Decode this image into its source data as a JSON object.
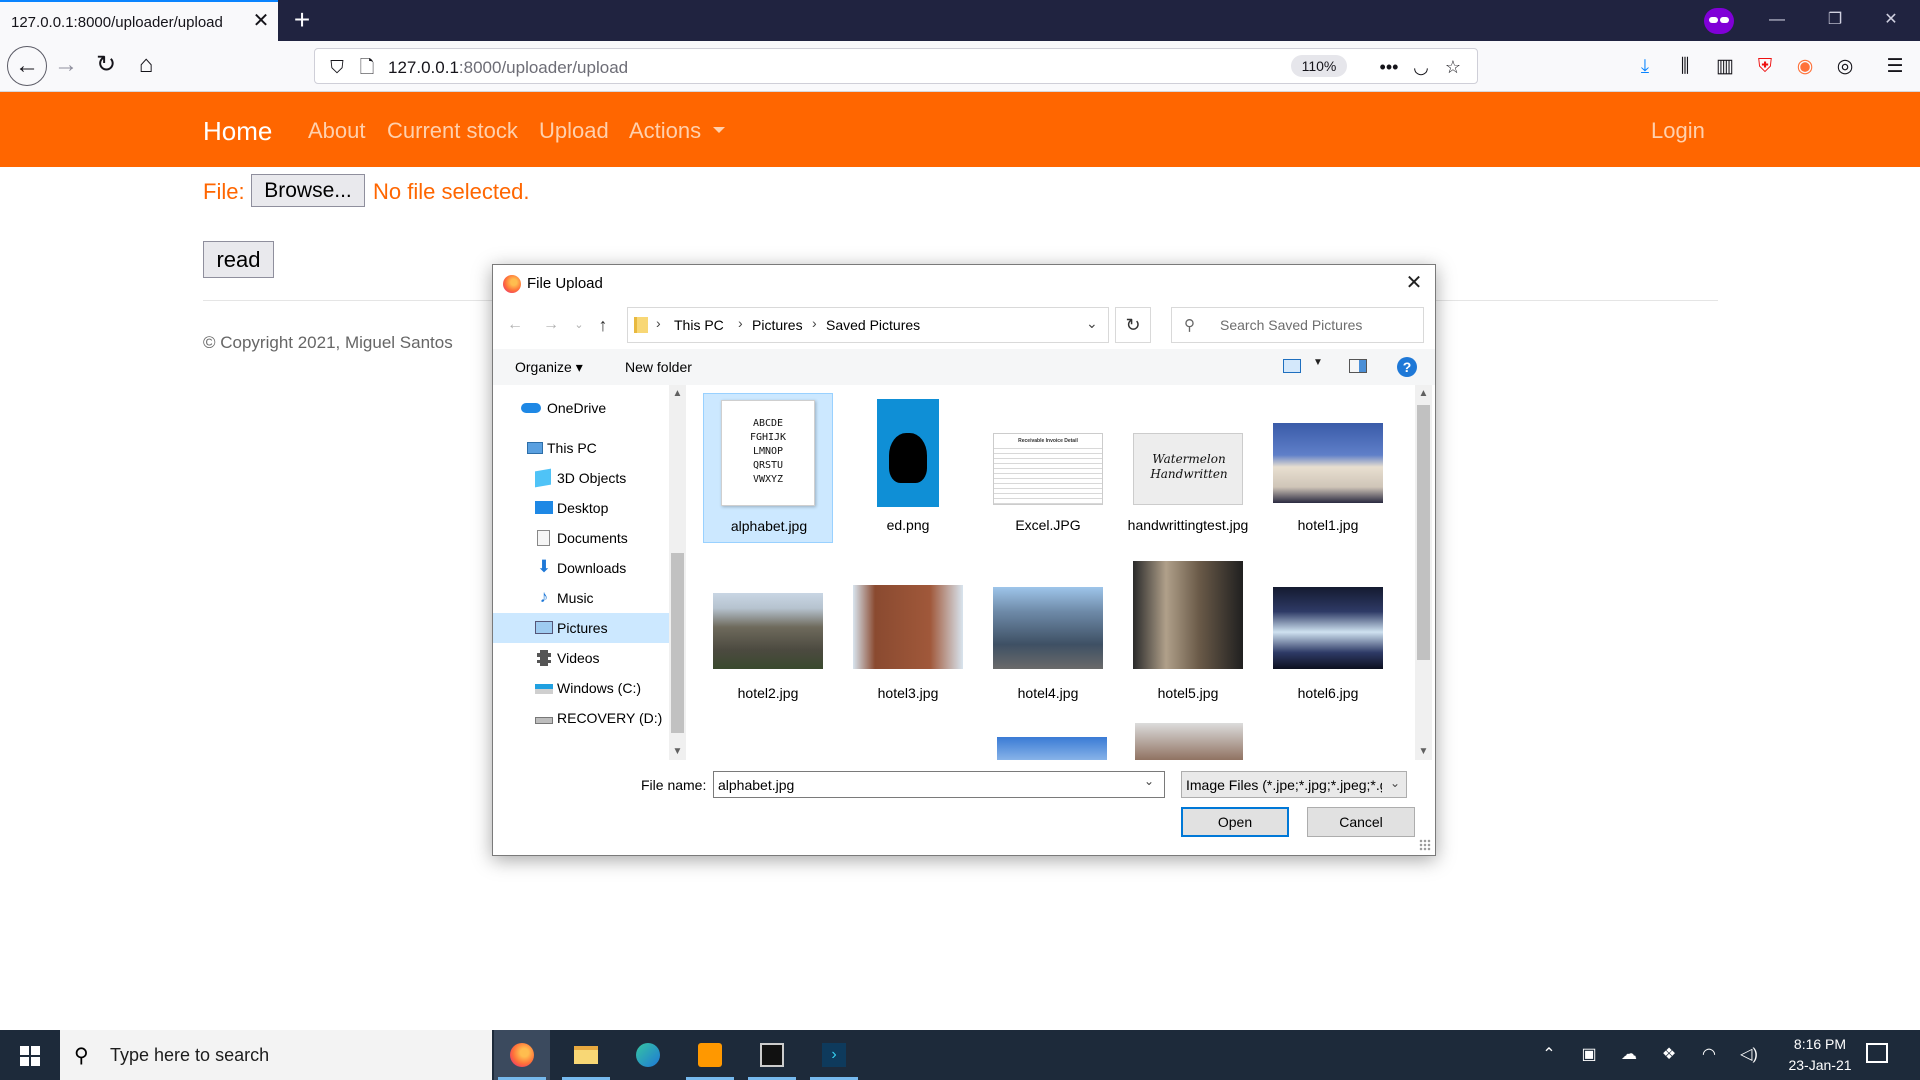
{
  "browser": {
    "tab_title": "127.0.0.1:8000/uploader/upload",
    "tab_close_glyph": "✕",
    "new_tab_glyph": "+",
    "url_host": "127.0.0.1",
    "url_path": ":8000/uploader/upload",
    "zoom": "110%",
    "more_glyph": "•••",
    "icons": [
      "private-browsing-icon",
      "minimize-icon",
      "restore-icon",
      "close-window-icon",
      "back-icon",
      "forward-icon",
      "reload-icon",
      "home-icon",
      "tracking-shield-icon",
      "page-icon",
      "more-icon",
      "pocket-icon",
      "bookmark-star-icon",
      "download-icon",
      "library-icon",
      "sidebar-icon",
      "ublock-icon",
      "extension-icon",
      "account-icon",
      "menu-icon"
    ]
  },
  "site": {
    "brand": "Home",
    "nav": [
      "About",
      "Current stock",
      "Upload",
      "Actions"
    ],
    "login": "Login",
    "accent_color": "#ff6600"
  },
  "form": {
    "file_label": "File:",
    "browse_label": "Browse...",
    "no_file": "No file selected.",
    "read_label": "read"
  },
  "footer": {
    "copyright": "© Copyright 2021, Miguel Santos"
  },
  "dialog": {
    "title": "File Upload",
    "breadcrumbs": [
      "This PC",
      "Pictures",
      "Saved Pictures"
    ],
    "search_placeholder": "Search Saved Pictures",
    "organize": "Organize",
    "new_folder": "New folder",
    "help_glyph": "?",
    "nav_items": [
      {
        "label": "OneDrive",
        "icon": "onedrive-icon"
      },
      {
        "label": "This PC",
        "icon": "this-pc-icon"
      },
      {
        "label": "3D Objects",
        "icon": "3d-objects-icon"
      },
      {
        "label": "Desktop",
        "icon": "desktop-icon"
      },
      {
        "label": "Documents",
        "icon": "documents-icon"
      },
      {
        "label": "Downloads",
        "icon": "downloads-icon"
      },
      {
        "label": "Music",
        "icon": "music-icon"
      },
      {
        "label": "Pictures",
        "icon": "pictures-icon"
      },
      {
        "label": "Videos",
        "icon": "videos-icon"
      },
      {
        "label": "Windows (C:)",
        "icon": "drive-c-icon"
      },
      {
        "label": "RECOVERY (D:)",
        "icon": "drive-d-icon"
      }
    ],
    "files": [
      {
        "name": "alphabet.jpg",
        "letters": [
          "ABCDE",
          "FGHIJK",
          "LMNOP",
          "QRSTU",
          "VWXYZ"
        ]
      },
      {
        "name": "ed.png"
      },
      {
        "name": "Excel.JPG",
        "caption": "Receivable Invoice Detail"
      },
      {
        "name": "handwrittingtest.jpg",
        "caption": "Watermelon Handwritten"
      },
      {
        "name": "hotel1.jpg"
      },
      {
        "name": "hotel2.jpg"
      },
      {
        "name": "hotel3.jpg"
      },
      {
        "name": "hotel4.jpg"
      },
      {
        "name": "hotel5.jpg"
      },
      {
        "name": "hotel6.jpg"
      }
    ],
    "filename_label": "File name:",
    "filename_value": "alphabet.jpg",
    "filetype": "Image Files (*.jpe;*.jpg;*.jpeg;*.g",
    "open_label": "Open",
    "cancel_label": "Cancel"
  },
  "taskbar": {
    "search_placeholder": "Type here to search",
    "apps": [
      "firefox-icon",
      "file-explorer-icon",
      "edge-icon",
      "sublime-text-icon",
      "terminal-icon",
      "powershell-icon"
    ],
    "tray_icons": [
      "chevron-up-icon",
      "meet-now-icon",
      "onedrive-tray-icon",
      "dropbox-icon",
      "wifi-icon",
      "volume-icon"
    ],
    "time": "8:16 PM",
    "date": "23-Jan-21"
  }
}
